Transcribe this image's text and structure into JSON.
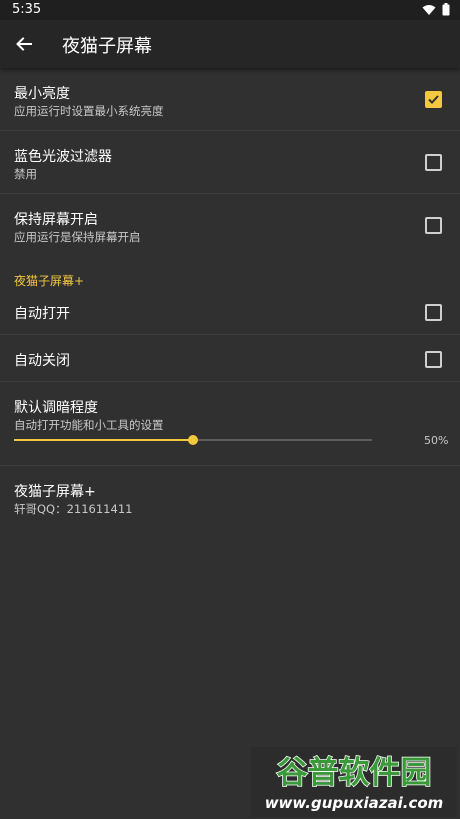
{
  "status_bar": {
    "time": "5:35"
  },
  "app_bar": {
    "title": "夜猫子屏幕"
  },
  "settings": [
    {
      "title": "最小亮度",
      "subtitle": "应用运行时设置最小系统亮度",
      "checked": true
    },
    {
      "title": "蓝色光波过滤器",
      "subtitle": "禁用",
      "checked": false
    },
    {
      "title": "保持屏幕开启",
      "subtitle": "应用运行是保持屏幕开启",
      "checked": false
    }
  ],
  "section_header": "夜猫子屏幕+",
  "auto_settings": [
    {
      "title": "自动打开",
      "checked": false
    },
    {
      "title": "自动关闭",
      "checked": false
    }
  ],
  "dim_level": {
    "title": "默认调暗程度",
    "subtitle": "自动打开功能和小工具的设置",
    "value_label": "50%",
    "value": 0.5
  },
  "about": {
    "title": "夜猫子屏幕+",
    "subtitle": "轩哥QQ：211611411"
  },
  "watermark": {
    "brand": "谷普软件园",
    "url": "www.gupuxiazai.com"
  },
  "colors": {
    "accent": "#f3c83f",
    "background": "#303030",
    "app_bar": "#262626"
  }
}
